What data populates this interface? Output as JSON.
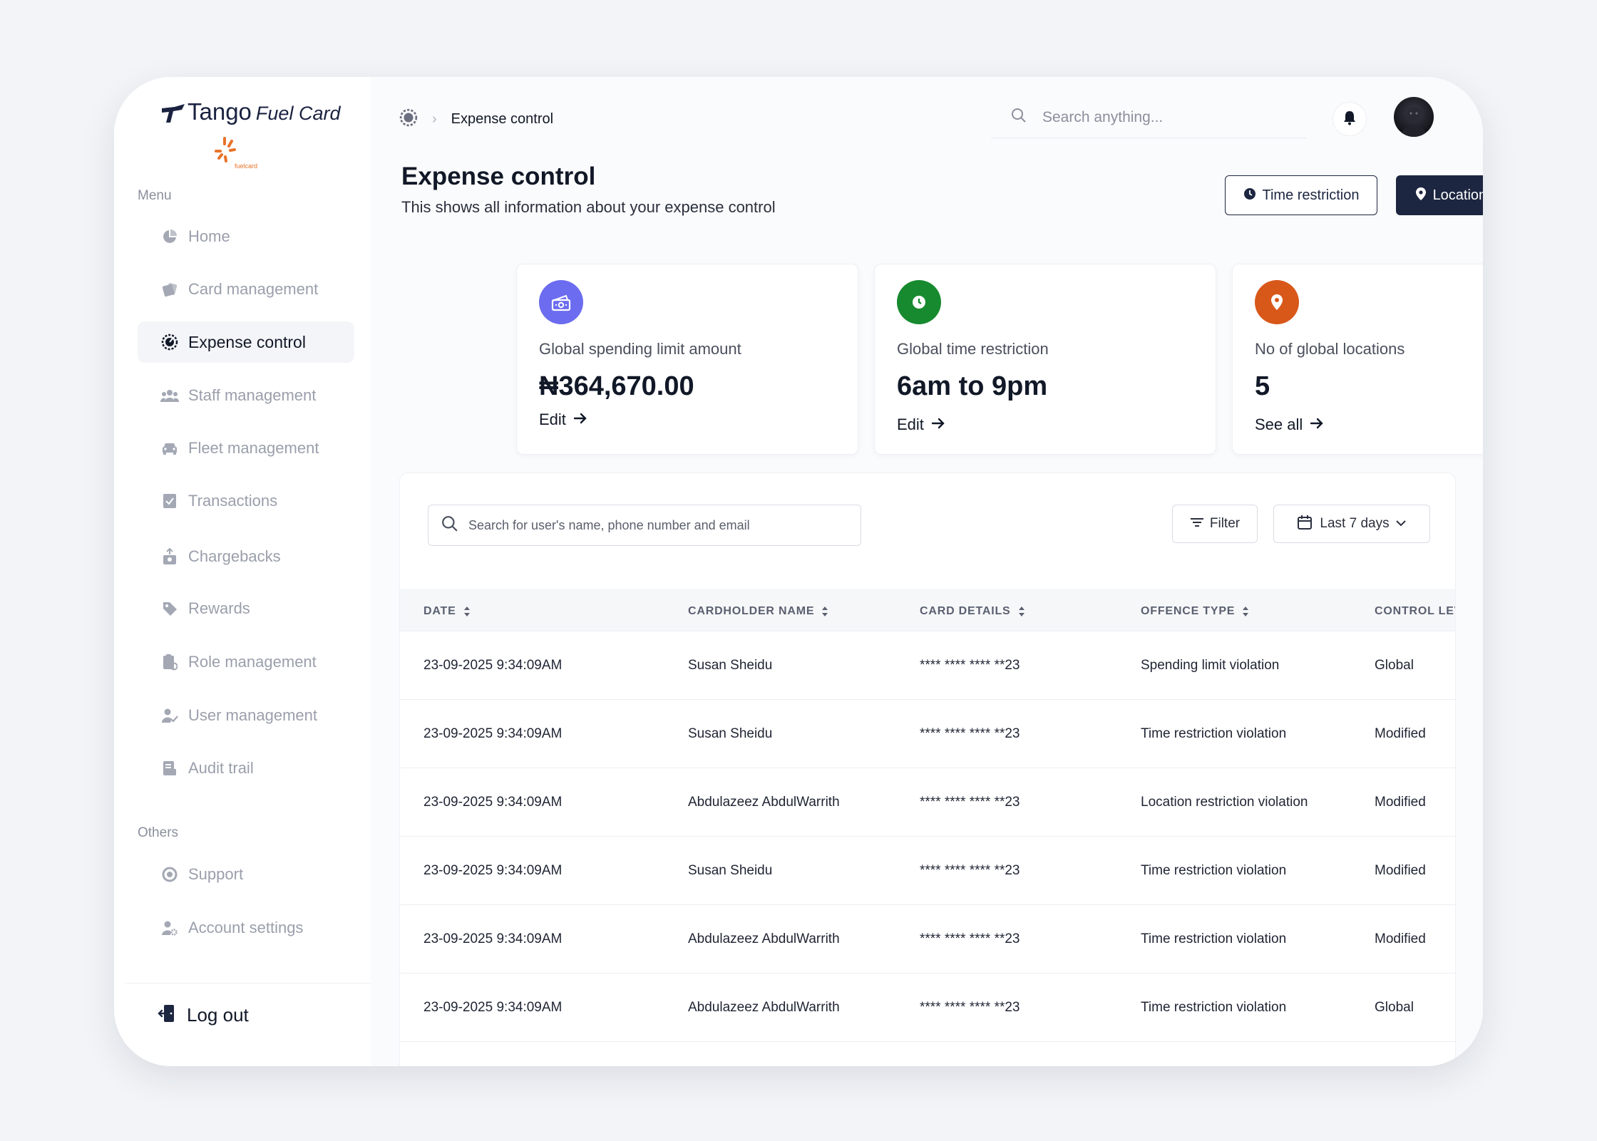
{
  "brand": {
    "name": "Tango",
    "product": "Fuel Card",
    "sub": "fuelcard"
  },
  "sidebar": {
    "menu_label": "Menu",
    "items": [
      {
        "label": "Home",
        "icon": "pie-chart-icon"
      },
      {
        "label": "Card management",
        "icon": "cards-icon"
      },
      {
        "label": "Expense control",
        "icon": "gauge-icon",
        "active": true
      },
      {
        "label": "Staff management",
        "icon": "users-icon"
      },
      {
        "label": "Fleet management",
        "icon": "car-icon"
      },
      {
        "label": "Transactions",
        "icon": "receipt-icon"
      },
      {
        "label": "Chargebacks",
        "icon": "chargeback-icon"
      },
      {
        "label": "Rewards",
        "icon": "tag-icon"
      },
      {
        "label": "Role management",
        "icon": "clipboard-icon"
      },
      {
        "label": "User management",
        "icon": "user-check-icon"
      },
      {
        "label": "Audit trail",
        "icon": "document-icon"
      }
    ],
    "others_label": "Others",
    "others": [
      {
        "label": "Support",
        "icon": "support-icon"
      },
      {
        "label": "Account settings",
        "icon": "user-gear-icon"
      }
    ],
    "logout_label": "Log out"
  },
  "header": {
    "breadcrumb_current": "Expense control",
    "search_placeholder": "Search anything..."
  },
  "page": {
    "title": "Expense control",
    "subtitle": "This shows all information about your expense control",
    "time_restriction_label": "Time restriction",
    "location_restriction_label": "Location restriction"
  },
  "cards": [
    {
      "title": "Global spending limit amount",
      "value": "₦364,670.00",
      "link": "Edit",
      "color": "#6c6cf0",
      "icon": "money-icon"
    },
    {
      "title": "Global time restriction",
      "value": "6am to 9pm",
      "link": "Edit",
      "color": "#178a2f",
      "icon": "clock-icon"
    },
    {
      "title": "No of global locations",
      "value": "5",
      "link": "See all",
      "color": "#d8581a",
      "icon": "location-pin-icon"
    }
  ],
  "table": {
    "search_placeholder": "Search for user's name, phone number and email",
    "filter_label": "Filter",
    "date_range_label": "Last 7 days",
    "columns": [
      "DATE",
      "CARDHOLDER NAME",
      "CARD DETAILS",
      "OFFENCE TYPE",
      "CONTROL LEVEL"
    ],
    "rows": [
      {
        "date": "23-09-2025 9:34:09AM",
        "name": "Susan Sheidu",
        "card": "**** **** **** **23",
        "offence": "Spending limit violation",
        "level": "Global"
      },
      {
        "date": "23-09-2025 9:34:09AM",
        "name": "Susan Sheidu",
        "card": "**** **** **** **23",
        "offence": "Time restriction violation",
        "level": "Modified"
      },
      {
        "date": "23-09-2025 9:34:09AM",
        "name": "Abdulazeez AbdulWarrith",
        "card": "**** **** **** **23",
        "offence": "Location restriction violation",
        "level": "Modified"
      },
      {
        "date": "23-09-2025 9:34:09AM",
        "name": "Susan Sheidu",
        "card": "**** **** **** **23",
        "offence": "Time restriction violation",
        "level": "Modified"
      },
      {
        "date": "23-09-2025 9:34:09AM",
        "name": "Abdulazeez AbdulWarrith",
        "card": "**** **** **** **23",
        "offence": "Time restriction violation",
        "level": "Modified"
      },
      {
        "date": "23-09-2025 9:34:09AM",
        "name": "Abdulazeez AbdulWarrith",
        "card": "**** **** **** **23",
        "offence": "Time restriction violation",
        "level": "Global"
      }
    ]
  },
  "colors": {
    "primary_dark": "#1d2640",
    "accent_orange": "#e8732a"
  }
}
